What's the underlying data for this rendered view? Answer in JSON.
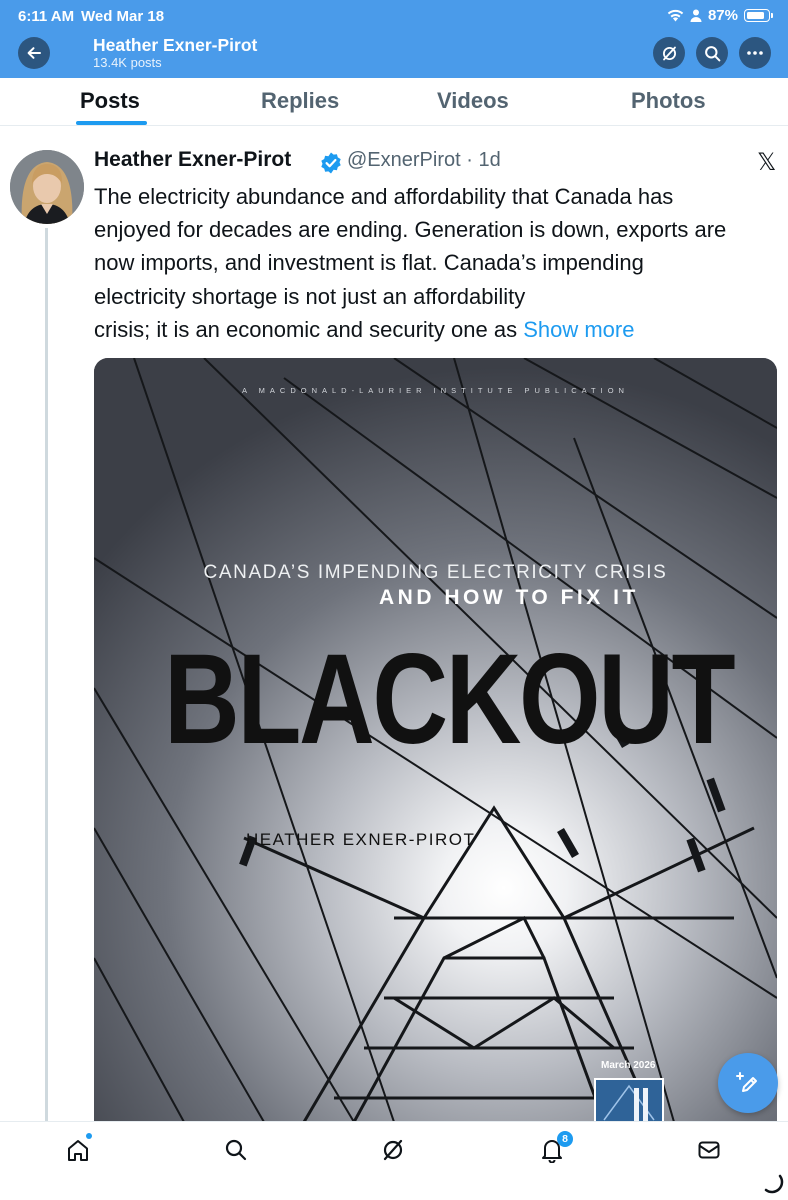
{
  "status_bar": {
    "time": "6:11 AM",
    "date": "Wed Mar 18",
    "battery": "87%",
    "battery_level": 0.87
  },
  "header": {
    "name": "Heather Exner-Pirot",
    "posts_count": "13.4K posts"
  },
  "tabs": [
    {
      "label": "Posts",
      "active": true
    },
    {
      "label": "Replies",
      "active": false
    },
    {
      "label": "Videos",
      "active": false
    },
    {
      "label": "Photos",
      "active": false
    }
  ],
  "tweet": {
    "author_name": "Heather Exner-Pirot",
    "handle_time": "@ExnerPirot · 1d",
    "text_lines": [
      "The electricity abundance and affordability that Canada has",
      "enjoyed for decades are ending. Generation is down, exports are",
      "now imports, and investment is flat. Canada’s impending",
      "electricity shortage is not just an affordability",
      "crisis; it is an economic and security one as "
    ],
    "show_more": "Show more",
    "x_logo": "𝕏",
    "media": {
      "publisher": "A MACDONALD-LAURIER INSTITUTE PUBLICATION",
      "subtitle_1": "CANADA’S IMPENDING ELECTRICITY CRISIS",
      "subtitle_2": "AND HOW TO FIX IT",
      "title": "BLACKOUT",
      "author": "HEATHER EXNER-PIROT",
      "date": "March 2026"
    }
  },
  "bottom_nav": {
    "notifications_badge": "8",
    "icons": [
      "home-icon",
      "search-icon",
      "grok-icon",
      "bell-icon",
      "mail-icon"
    ]
  },
  "colors": {
    "header_bg": "#4a9bea",
    "accent": "#1d9bf0",
    "text": "#0f1419",
    "muted": "#536471"
  }
}
